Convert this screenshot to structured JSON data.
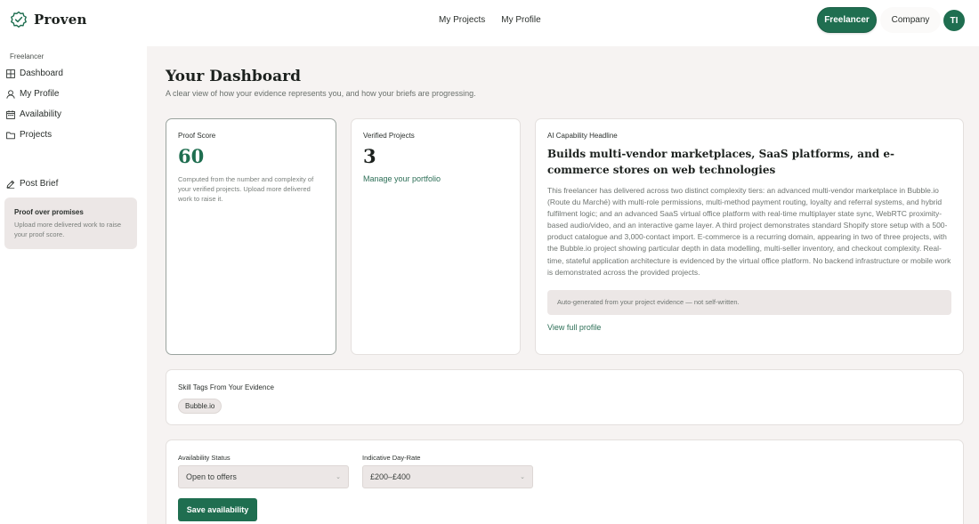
{
  "brand": {
    "name": "Proven",
    "logo_icon": "badge-check-icon"
  },
  "top_nav": {
    "items": [
      "My Projects",
      "My Profile"
    ]
  },
  "mode_toggle": {
    "freelancer": "Freelancer",
    "company": "Company",
    "active": "Freelancer"
  },
  "avatar": {
    "initials": "TI"
  },
  "sidebar": {
    "section_label": "Freelancer",
    "items": [
      {
        "label": "Dashboard",
        "icon": "grid-icon"
      },
      {
        "label": "My Profile",
        "icon": "user-icon"
      },
      {
        "label": "Availability",
        "icon": "calendar-icon"
      },
      {
        "label": "Projects",
        "icon": "folder-icon"
      }
    ],
    "post_brief": {
      "label": "Post Brief",
      "icon": "pen-icon"
    },
    "promo": {
      "title": "Proof over promises",
      "text": "Upload more delivered work to raise your proof score."
    }
  },
  "main": {
    "title": "Your Dashboard",
    "subtitle": "A clear view of how your evidence represents you, and how your briefs are progressing."
  },
  "proof_card": {
    "label": "Proof Score",
    "value": "60",
    "description": "Computed from the number and complexity of your verified projects. Upload more delivered work to raise it."
  },
  "verified_card": {
    "label": "Verified Projects",
    "value": "3",
    "link": "Manage your portfolio"
  },
  "ai_card": {
    "label": "AI Capability Headline",
    "headline": "Builds multi-vendor marketplaces, SaaS platforms, and e-commerce stores on web technologies",
    "body": "This freelancer has delivered across two distinct complexity tiers: an advanced multi-vendor marketplace in Bubble.io (Route du Marché) with multi-role permissions, multi-method payment routing, loyalty and referral systems, and hybrid fulfilment logic; and an advanced SaaS virtual office platform with real-time multiplayer state sync, WebRTC proximity-based audio/video, and an interactive game layer. A third project demonstrates standard Shopify store setup with a 500-product catalogue and 3,000-contact import. E-commerce is a recurring domain, appearing in two of three projects, with the Bubble.io project showing particular depth in data modelling, multi-seller inventory, and checkout complexity. Real-time, stateful application architecture is evidenced by the virtual office platform. No backend infrastructure or mobile work is demonstrated across the provided projects.",
    "note": "Auto-generated from your project evidence — not self-written.",
    "link": "View full profile"
  },
  "skills_card": {
    "label": "Skill Tags From Your Evidence",
    "tags": [
      "Bubble.io"
    ]
  },
  "availability_card": {
    "status_label": "Availability Status",
    "status_value": "Open to offers",
    "rate_label": "Indicative Day-Rate",
    "rate_value": "£200–£400",
    "save_label": "Save availability"
  },
  "colors": {
    "accent": "#1f6e50",
    "main_bg": "#f6f3f2",
    "chip_bg": "#ece7e6"
  }
}
